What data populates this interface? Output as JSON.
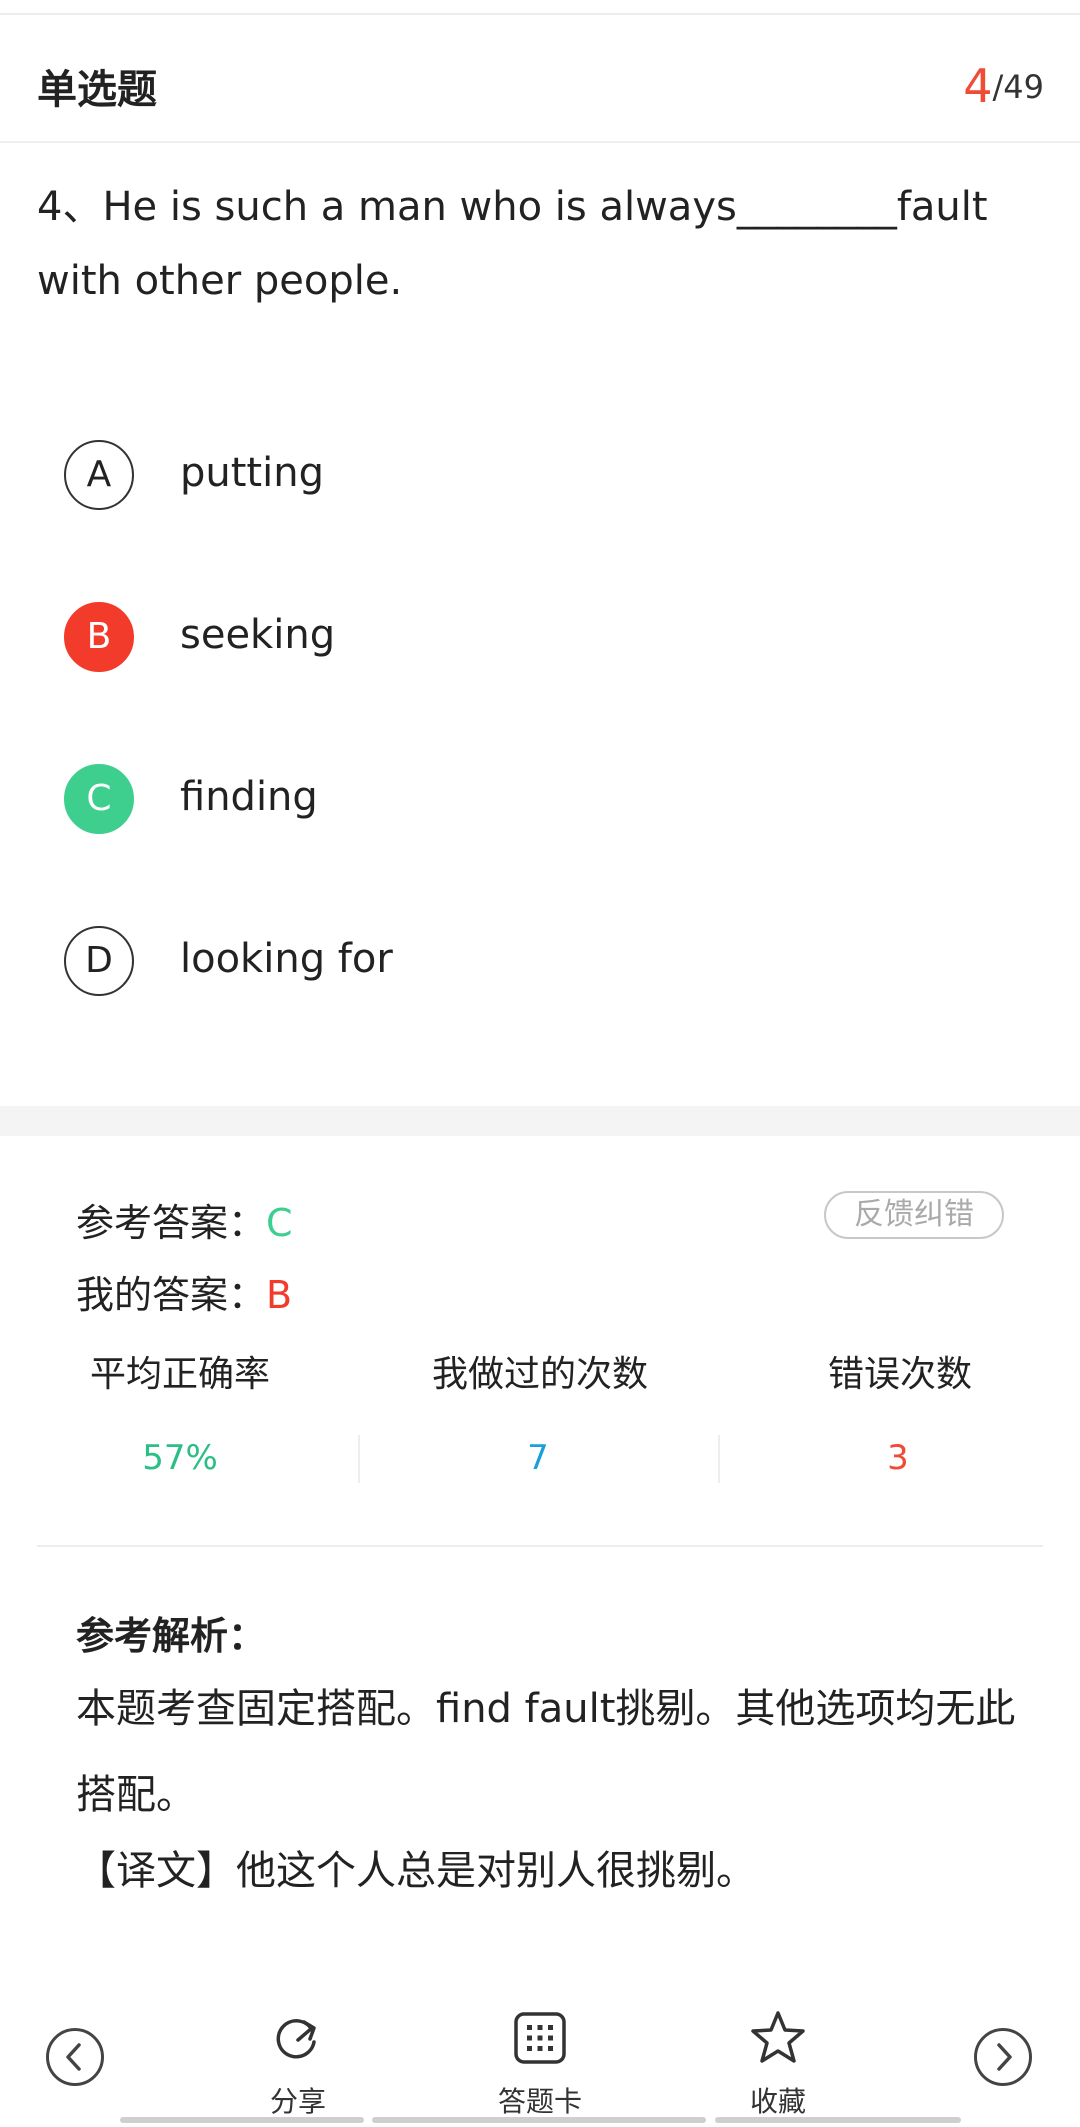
{
  "header": {
    "title": "单选题",
    "current": "4",
    "total": "/49"
  },
  "question": {
    "text": "4、He is such a man who is always________fault with other people."
  },
  "options": [
    {
      "letter": "A",
      "text": "putting",
      "state": "none"
    },
    {
      "letter": "B",
      "text": "seeking",
      "state": "wrong"
    },
    {
      "letter": "C",
      "text": "finding",
      "state": "correct"
    },
    {
      "letter": "D",
      "text": "looking for",
      "state": "none"
    }
  ],
  "result": {
    "ref_label": "参考答案：",
    "ref_value": "C",
    "my_label": "我的答案：",
    "my_value": "B",
    "feedback_label": "反馈纠错"
  },
  "stats": {
    "avg_label": "平均正确率",
    "avg_value": "57%",
    "done_label": "我做过的次数",
    "done_value": "7",
    "wrong_label": "错误次数",
    "wrong_value": "3"
  },
  "analysis": {
    "title": "参考解析：",
    "body": "本题考查固定搭配。find fault挑剔。其他选项均无此搭配。",
    "translation": "【译文】他这个人总是对别人很挑剔。"
  },
  "toolbar": {
    "prev_icon": "chevron-left-icon",
    "share_label": "分享",
    "answer_card_label": "答题卡",
    "favorite_label": "收藏",
    "next_icon": "chevron-right-icon"
  },
  "colors": {
    "accent_red": "#f04b35",
    "wrong": "#f23b2a",
    "correct": "#3ecf8e",
    "avg_green": "#2bbf86",
    "count_blue": "#1a9fd8",
    "error_red": "#f04b35"
  }
}
